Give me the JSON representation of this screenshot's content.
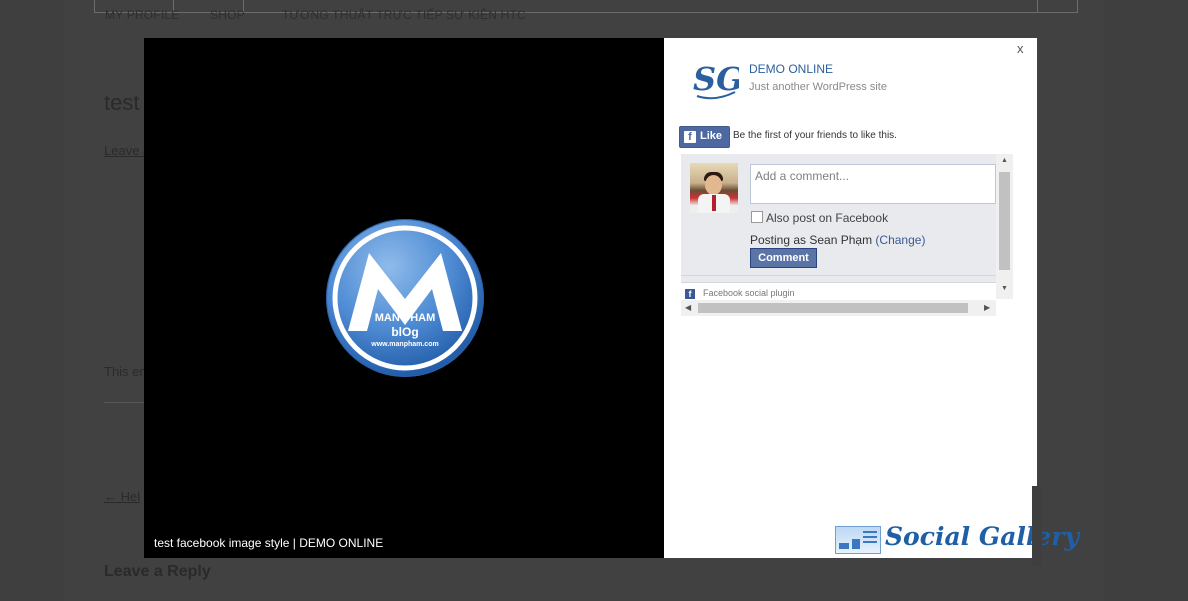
{
  "background_page": {
    "nav": [
      "MY PROFILE",
      "SHOP",
      "TƯƠNG THUẬT TRỰC TIẾP SỰ KIỆN HTC"
    ],
    "post_title": "test",
    "leave_link": "Leave a",
    "body_text": "This en",
    "prev_link": "← Hel",
    "reply_heading": "Leave a Reply"
  },
  "lightbox": {
    "caption": "test facebook image style | DEMO ONLINE",
    "image_logo": {
      "line1": "MAN PHAM",
      "line2": "blOg",
      "url": "www.manpham.com"
    },
    "close_label": "x",
    "site": {
      "logo_letters": "SG",
      "title": "DEMO ONLINE",
      "tagline": "Just another WordPress site"
    },
    "facebook": {
      "like_icon": "f",
      "like_button": "Like",
      "like_text": "Be the first of your friends to like this.",
      "comment_placeholder": "Add a comment...",
      "also_post": "Also post on Facebook",
      "posting_as": "Posting as Sean Phạm",
      "change_link": "(Change)",
      "comment_button": "Comment",
      "plugin_icon": "f",
      "plugin_text": "Facebook social plugin"
    },
    "brand": "Social Gallery"
  },
  "colors": {
    "fb_blue": "#3b5998",
    "site_blue": "#2b5f9e",
    "brand_blue": "#1f5fa6"
  }
}
